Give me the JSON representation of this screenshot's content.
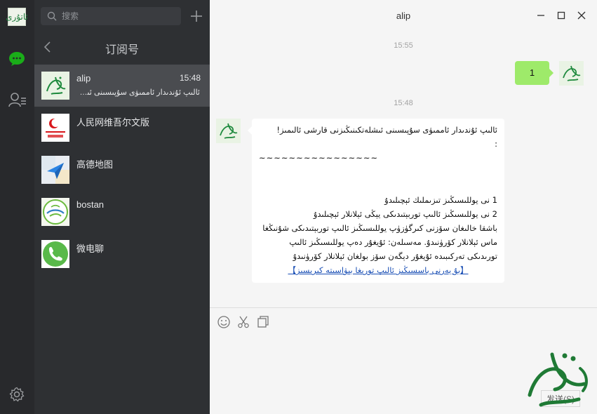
{
  "rail": {
    "avatar_text": "ئاتۇرى",
    "icons": [
      "chat-icon",
      "contacts-icon",
      "settings-icon"
    ]
  },
  "search": {
    "placeholder": "搜索"
  },
  "subscriptions": {
    "title": "订阅号",
    "items": [
      {
        "name": "alip",
        "time": "15:48",
        "preview": "ئالىپ ئۇندىدار ئاممىۋى سۇپىسىنى ئىشلىتى...",
        "thumb": "alip-logo",
        "active": true
      },
      {
        "name": "人民网维吾尔文版",
        "time": "",
        "preview": "",
        "thumb": "people-daily-uyghur-logo",
        "active": false
      },
      {
        "name": "高德地图",
        "time": "",
        "preview": "",
        "thumb": "amap-logo",
        "active": false
      },
      {
        "name": "bostan",
        "time": "",
        "preview": "",
        "thumb": "bostan-logo",
        "active": false
      },
      {
        "name": "微电聊",
        "time": "",
        "preview": "",
        "thumb": "phone-logo",
        "active": false
      }
    ]
  },
  "chat": {
    "title": "alip",
    "timestamp_1": "15:55",
    "timestamp_2": "15:48",
    "my_message": "1",
    "reply_lines": [
      "ئالىپ ئۇندىدار ئاممىۋى سۇپىسىنى ئىشلەتكىنىڭىزنى قارشى ئالىمىز!",
      ":",
      "~~~~~~~~~~~~~~~~"
    ],
    "reply_lines_2": [
      "1 نى يوللىسىڭىز تىزىملىك ئېچىلىدۇ",
      "2 نى يوللىسىڭىز ئالىپ توربېتىدىكى يېڭى ئېلانلار ئېچىلىدۇ",
      "باشقا خالىغان سۆزنى كىرگۈزۈپ يوللىسىڭىز ئالىپ توربېتىدىكى شۇنىڭغا ماس ئېلانلار كۆرۈنىدۇ. مەسىلەن: ئۇيغۇر دەپ يوللىسىڭىز ئالىپ تورىدىكى تەركىبىدە ئۇيغۇر دېگەن سۆز بولغان ئېلانلار كۆرۈنىدۇ"
    ],
    "reply_link": "【بۇ يەرنى باسسىڭىز ئالىپ تورىغا بىۋاسىتە كىرىسىز】"
  },
  "composer": {
    "send_label": "发送(S)"
  },
  "colors": {
    "accent_green": "#9eea6a",
    "sidebar": "#2e3033",
    "rail": "#28292c",
    "link": "#1a4fb5"
  }
}
